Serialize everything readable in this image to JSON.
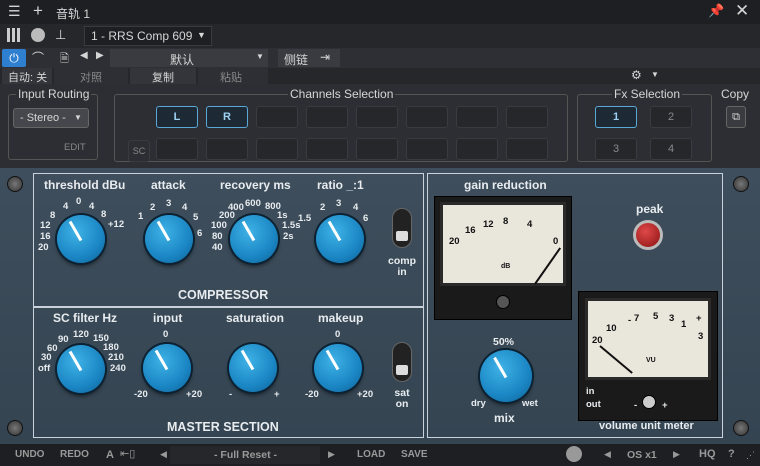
{
  "titlebar": {
    "track_name": "音轨 1"
  },
  "toolbar": {
    "preset_slot": "1 - RRS Comp 609",
    "preset_name": "默认",
    "sidechain_label": "侧链"
  },
  "row3": {
    "auto_label": "自动: 关",
    "compare": "对照",
    "copy": "复制",
    "paste": "粘贴"
  },
  "routing": {
    "input_routing_label": "Input Routing",
    "routing_value": "- Stereo -",
    "edit_label": "EDIT",
    "channels_label": "Channels Selection",
    "channel_L": "L",
    "channel_R": "R",
    "sc_label": "SC",
    "fx_label": "Fx Selection",
    "fx": [
      "1",
      "2",
      "3",
      "4"
    ],
    "copy_label": "Copy"
  },
  "compressor": {
    "title": "COMPRESSOR",
    "threshold": {
      "label": "threshold dBu",
      "ticks": [
        "0",
        "4",
        "8",
        "4",
        "8",
        "12",
        "16",
        "20",
        "+12"
      ]
    },
    "attack": {
      "label": "attack",
      "ticks": [
        "1",
        "2",
        "3",
        "4",
        "5",
        "6"
      ]
    },
    "recovery": {
      "label": "recovery ms",
      "ticks": [
        "400",
        "600",
        "800",
        "200",
        "1s",
        "100",
        "1.5s",
        "80",
        "2s",
        "40"
      ]
    },
    "ratio": {
      "label": "ratio _:1",
      "ticks": [
        "3",
        "2",
        "4",
        "1.5",
        "6"
      ]
    },
    "comp_in": "comp in"
  },
  "master": {
    "title": "MASTER SECTION",
    "scfilter": {
      "label": "SC filter Hz",
      "ticks": [
        "120",
        "90",
        "150",
        "60",
        "180",
        "30",
        "210",
        "off",
        "240"
      ]
    },
    "input": {
      "label": "input",
      "ticks": [
        "0",
        "-20",
        "+20"
      ]
    },
    "saturation": {
      "label": "saturation",
      "ticks": [
        "-",
        "+"
      ]
    },
    "makeup": {
      "label": "makeup",
      "ticks": [
        "0",
        "-20",
        "+20"
      ]
    },
    "sat_on": "sat on"
  },
  "gain_reduction": {
    "label": "gain reduction",
    "ticks": [
      "12",
      "8",
      "16",
      "4",
      "20",
      "0"
    ],
    "unit": "dB"
  },
  "peak_label": "peak",
  "mix": {
    "label": "mix",
    "value": "50%",
    "dry": "dry",
    "wet": "wet"
  },
  "vu": {
    "label": "volume unit meter",
    "ticks": [
      "5",
      "3",
      "1",
      "7",
      "10",
      "-",
      "20",
      "+",
      "3"
    ],
    "unit": "VU",
    "in": "in",
    "out": "out",
    "minus": "-",
    "plus": "+"
  },
  "footer": {
    "undo": "UNDO",
    "redo": "REDO",
    "a": "A",
    "preset": "- Full Reset -",
    "load": "LOAD",
    "save": "SAVE",
    "os": "OS x1",
    "hq": "HQ",
    "help": "?"
  }
}
